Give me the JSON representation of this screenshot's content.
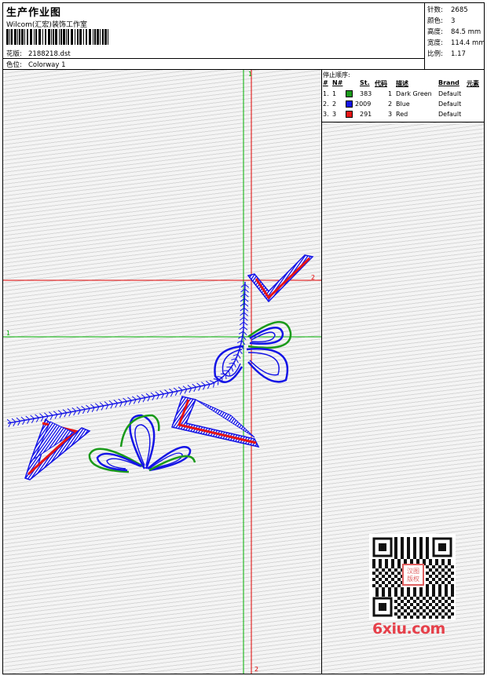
{
  "header": {
    "title": "生产作业图",
    "company": "Wilcom(汇宏)装饰工作室",
    "design_label": "花版:",
    "design_value": "2188218.dst",
    "colorway_label": "色位:",
    "colorway_value": "Colorway 1"
  },
  "stats": [
    {
      "label": "针数:",
      "value": "2685"
    },
    {
      "label": "颜色:",
      "value": "3"
    },
    {
      "label": "高度:",
      "value": "84.5 mm"
    },
    {
      "label": "宽度:",
      "value": "114.4 mm"
    },
    {
      "label": "比例:",
      "value": "1.17"
    }
  ],
  "color_table": {
    "title": "停止顺序:",
    "headers": {
      "hash": "#",
      "n": "N#",
      "st": "St.",
      "code": "代码",
      "desc": "描述",
      "brand": "Brand",
      "elem": "元素"
    },
    "rows": [
      {
        "idx": "1.",
        "n": "1",
        "st": "383",
        "code": "1",
        "desc": "Dark Green",
        "brand": "Default",
        "color": "#1a9a1a"
      },
      {
        "idx": "2.",
        "n": "2",
        "st": "2009",
        "code": "2",
        "desc": "Blue",
        "brand": "Default",
        "color": "#1414e6"
      },
      {
        "idx": "3.",
        "n": "3",
        "st": "291",
        "code": "3",
        "desc": "Red",
        "brand": "Default",
        "color": "#e61414"
      }
    ]
  },
  "axes": {
    "green_label_top": "1",
    "green_label_left": "1",
    "red_label_right": "2",
    "red_label_bottom": "2",
    "green_color": "#00b000",
    "red_color": "#e00000"
  },
  "watermark": {
    "text": "6xiu.com",
    "seal_text": "汉图版权"
  }
}
